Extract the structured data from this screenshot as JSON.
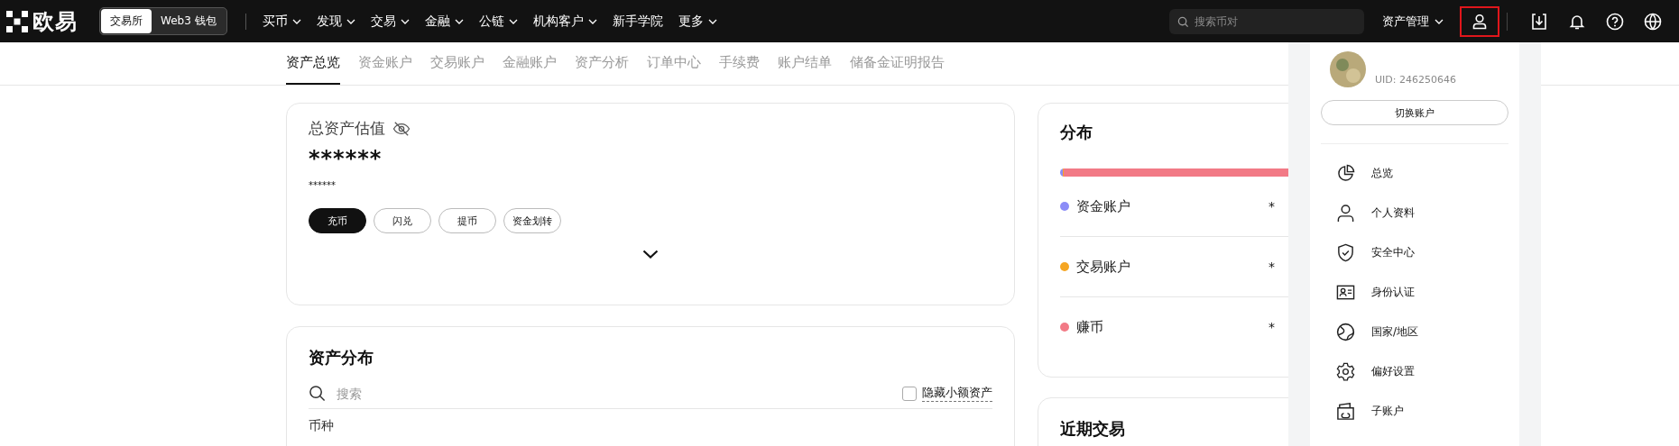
{
  "header": {
    "logo": "欧易",
    "mode_tabs": [
      {
        "label": "交易所",
        "selected": true
      },
      {
        "label": "Web3 钱包",
        "selected": false
      }
    ],
    "nav": [
      {
        "label": "买币",
        "dropdown": true
      },
      {
        "label": "发现",
        "dropdown": true
      },
      {
        "label": "交易",
        "dropdown": true
      },
      {
        "label": "金融",
        "dropdown": true
      },
      {
        "label": "公链",
        "dropdown": true
      },
      {
        "label": "机构客户",
        "dropdown": true
      },
      {
        "label": "新手学院",
        "dropdown": false
      },
      {
        "label": "更多",
        "dropdown": true
      }
    ],
    "search": {
      "placeholder": "搜索币对"
    },
    "asset_menu": "资产管理"
  },
  "subnav": [
    {
      "label": "资产总览",
      "selected": true
    },
    {
      "label": "资金账户",
      "selected": false
    },
    {
      "label": "交易账户",
      "selected": false
    },
    {
      "label": "金融账户",
      "selected": false
    },
    {
      "label": "资产分析",
      "selected": false
    },
    {
      "label": "订单中心",
      "selected": false
    },
    {
      "label": "手续费",
      "selected": false
    },
    {
      "label": "账户结单",
      "selected": false
    },
    {
      "label": "储备金证明报告",
      "selected": false
    }
  ],
  "total": {
    "title": "总资产估值",
    "value": "******",
    "sub_value": "******",
    "buttons": [
      {
        "label": "充币",
        "primary": true
      },
      {
        "label": "闪兑",
        "primary": false
      },
      {
        "label": "提币",
        "primary": false
      },
      {
        "label": "资金划转",
        "primary": false
      }
    ]
  },
  "assets": {
    "title": "资产分布",
    "search_placeholder": "搜索",
    "hide_small": {
      "label": "隐藏小额资产",
      "checked": false
    },
    "column_1": "币种"
  },
  "distribution": {
    "title": "分布",
    "items": [
      {
        "name": "资金账户",
        "color": "#8b8cf7",
        "level": 0.01,
        "value": "*"
      },
      {
        "name": "交易账户",
        "color": "#f5a623",
        "level": 0.004,
        "value": "*"
      },
      {
        "name": "赚币",
        "color": "#f27a86",
        "level": 0.986,
        "value": "*"
      }
    ]
  },
  "recent": {
    "title": "近期交易"
  },
  "user_menu": {
    "uid": "UID: 246250646",
    "switch_button": "切换账户",
    "items": [
      {
        "label": "总览",
        "kind": "pie"
      },
      {
        "label": "个人资料",
        "kind": "person"
      },
      {
        "label": "安全中心",
        "kind": "shield"
      },
      {
        "label": "身份认证",
        "kind": "idcard"
      },
      {
        "label": "国家/地区",
        "kind": "globe"
      },
      {
        "label": "偏好设置",
        "kind": "gear"
      },
      {
        "label": "子账户",
        "kind": "wallet"
      }
    ]
  }
}
